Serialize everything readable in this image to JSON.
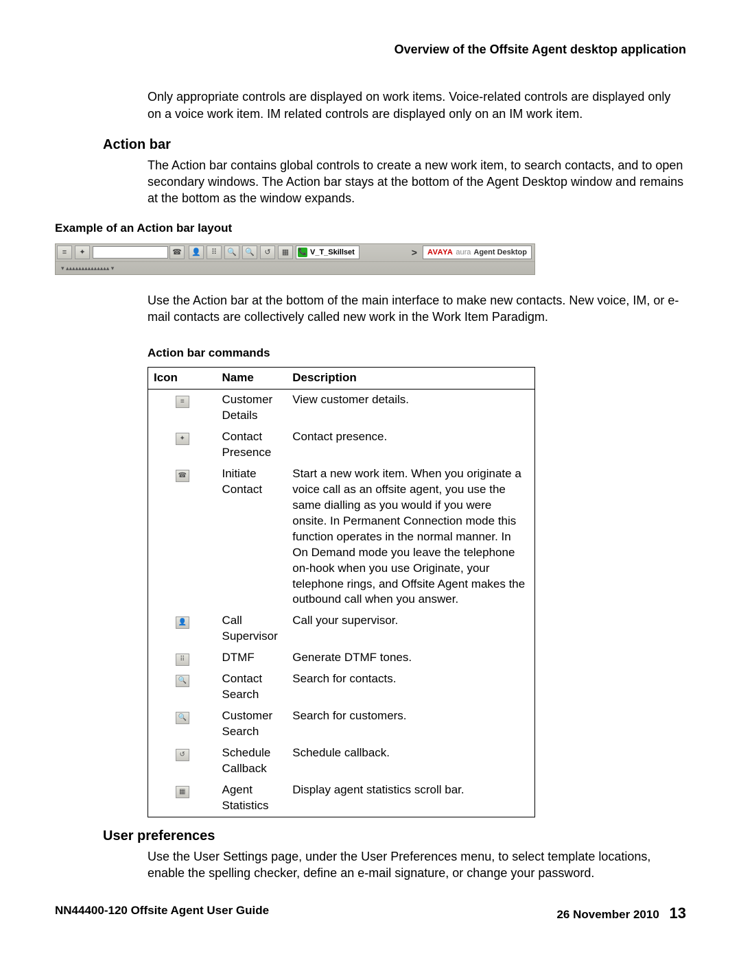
{
  "header": {
    "title": "Overview of the Offsite Agent desktop application"
  },
  "intro": "Only appropriate controls are displayed on work items. Voice-related controls are displayed only on a voice work item. IM related controls are displayed only on an IM work item.",
  "action_bar": {
    "heading": "Action bar",
    "desc": "The Action bar contains global controls to create a new work item, to search contacts, and to open secondary windows. The Action bar stays at the bottom of the Agent Desktop window and remains at the bottom as the window expands.",
    "example_heading": "Example of an Action bar layout",
    "skillset_label": "V_T_Skillset",
    "chevron": ">",
    "brand": {
      "avaya": "AVAYA",
      "aura": "aura",
      "desktop": "Agent Desktop"
    },
    "bottom_tab": "▾ ▴▴▴▴▴▴▴▴▴▴▴▴▴▴ ▾",
    "usage": "Use the Action bar at the bottom of the main interface to make new contacts. New voice, IM, or e-mail contacts are collectively called new work in the Work Item Paradigm."
  },
  "commands": {
    "caption": "Action bar commands",
    "headers": {
      "icon": "Icon",
      "name": "Name",
      "desc": "Description"
    },
    "rows": [
      {
        "name": "Customer Details",
        "desc": "View customer details."
      },
      {
        "name": "Contact Presence",
        "desc": "Contact presence."
      },
      {
        "name": "Initiate Contact",
        "desc": "Start a new work item. When you originate a voice call as an offsite agent, you use the same dialling as you would if you were onsite. In Permanent Connection mode this function operates in the normal manner. In On Demand mode you leave the telephone on-hook when you use Originate, your telephone rings, and Offsite Agent makes the outbound call when you answer."
      },
      {
        "name": "Call Supervisor",
        "desc": "Call your supervisor."
      },
      {
        "name": "DTMF",
        "desc": "Generate DTMF tones."
      },
      {
        "name": "Contact Search",
        "desc": "Search for contacts."
      },
      {
        "name": "Customer Search",
        "desc": "Search for customers."
      },
      {
        "name": "Schedule Callback",
        "desc": "Schedule callback."
      },
      {
        "name": "Agent Statistics",
        "desc": "Display agent statistics scroll bar."
      }
    ]
  },
  "user_prefs": {
    "heading": "User preferences",
    "desc": "Use the User Settings page, under the User Preferences menu, to select template locations, enable the spelling checker, define an e-mail signature, or change your password."
  },
  "footer": {
    "doc": "NN44400-120 Offsite Agent User Guide",
    "date": "26 November 2010",
    "page": "13"
  }
}
